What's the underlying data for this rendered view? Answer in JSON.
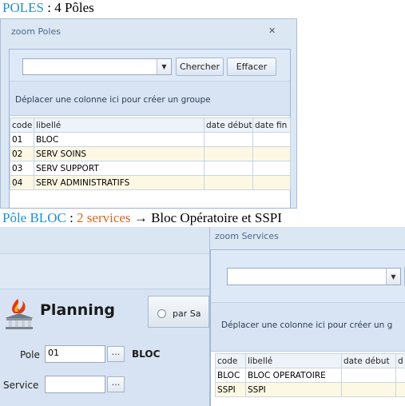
{
  "captions": {
    "top": {
      "name": "POLES",
      "rest": " : 4 Pôles"
    },
    "bottom": {
      "name": "Pôle BLOC",
      "sep": " : ",
      "count": "2 services",
      "rest": " → Bloc Opératoire et SSPI"
    }
  },
  "poles_window": {
    "title": "zoom Poles",
    "close_glyph": "✕",
    "search_value": "",
    "search_button": "Chercher",
    "clear_button": "Effacer",
    "group_hint": "Déplacer une colonne ici pour créer un groupe",
    "columns": [
      "code",
      "libellé",
      "date début",
      "date fin"
    ],
    "rows": [
      {
        "code": "01",
        "libelle": "BLOC",
        "date_debut": "",
        "date_fin": ""
      },
      {
        "code": "02",
        "libelle": "SERV SOINS",
        "date_debut": "",
        "date_fin": ""
      },
      {
        "code": "03",
        "libelle": "SERV SUPPORT",
        "date_debut": "",
        "date_fin": ""
      },
      {
        "code": "04",
        "libelle": "SERV ADMINISTRATIFS",
        "date_debut": "",
        "date_fin": ""
      }
    ]
  },
  "planning_panel": {
    "title": "Planning",
    "radio_label": "par Sa",
    "pole_label": "Pole",
    "pole_value": "01",
    "pole_name": "BLOC",
    "service_label": "Service",
    "service_value": "",
    "lookup_glyph": "···"
  },
  "services_window": {
    "title": "zoom Services",
    "search_value": "",
    "group_hint": "Déplacer une colonne ici pour créer un g",
    "columns": [
      "code",
      "libellé",
      "date début",
      "d"
    ],
    "rows": [
      {
        "code": "BLOC",
        "libelle": "BLOC OPERATOIRE",
        "date_debut": "",
        "date_fin": ""
      },
      {
        "code": "SSPI",
        "libelle": "SSPI",
        "date_debut": "",
        "date_fin": ""
      }
    ]
  },
  "colors": {
    "caption_name": "#1d8fd6",
    "caption_count": "#d2691e",
    "row_alt": "#fdf8e4"
  }
}
